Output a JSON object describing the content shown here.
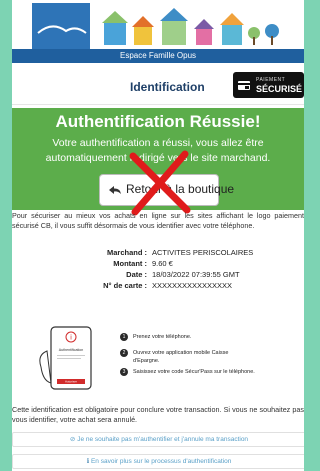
{
  "banner": {
    "strip_text": "Espace Famille Opus"
  },
  "identification": {
    "title": "Identification",
    "badge_line1": "PAIEMENT",
    "badge_line2": "SÉCURISÉ"
  },
  "success": {
    "title": "Authentification Réussie!",
    "message": "Votre authentification a réussi, vous allez être automatiquement redirigé vers le site marchand.",
    "return_label": "Retour à la boutique"
  },
  "secure_text": "Pour sécuriser au mieux vos achats en ligne sur les sites affichant le logo paiement sécurisé CB, il vous suffit désormais de vous identifier avec votre téléphone.",
  "details": [
    {
      "label": "Marchand :",
      "value": "ACTIVITES PERISCOLAIRES"
    },
    {
      "label": "Montant :",
      "value": "9.60 €"
    },
    {
      "label": "Date :",
      "value": "18/03/2022 07:39:55 GMT"
    },
    {
      "label": "N° de carte :",
      "value": "XXXXXXXXXXXXXXXX"
    }
  ],
  "phone_screen": {
    "title": "Authentification",
    "button": "Autoriser"
  },
  "steps": [
    {
      "num": "1",
      "text": "Prenez votre téléphone."
    },
    {
      "num": "2",
      "text": "Ouvrez votre application mobile Caisse d'Epargne."
    },
    {
      "num": "3",
      "text": "Saisissez votre code Sécur'Pass sur le téléphone."
    }
  ],
  "oblig_text": "Cette identification est obligatoire pour conclure votre transaction. Si vous ne souhaitez pas vous identifier, votre achat sera annulé.",
  "links": {
    "cancel": "Je ne souhaite pas m'authentifier et j'annule ma transaction",
    "info": "En savoir plus sur le processus d'authentification"
  },
  "colors": {
    "success_green": "#5cad4b",
    "cross_red": "#e01b1b",
    "outer_bg": "#7dd3b3",
    "banner_blue": "#1f5f9e"
  },
  "icons": [
    "house-icons",
    "lock-card-icon",
    "return-arrow-icon",
    "red-cross-mark",
    "phone-icon",
    "circle-slash-icon",
    "info-icon"
  ]
}
